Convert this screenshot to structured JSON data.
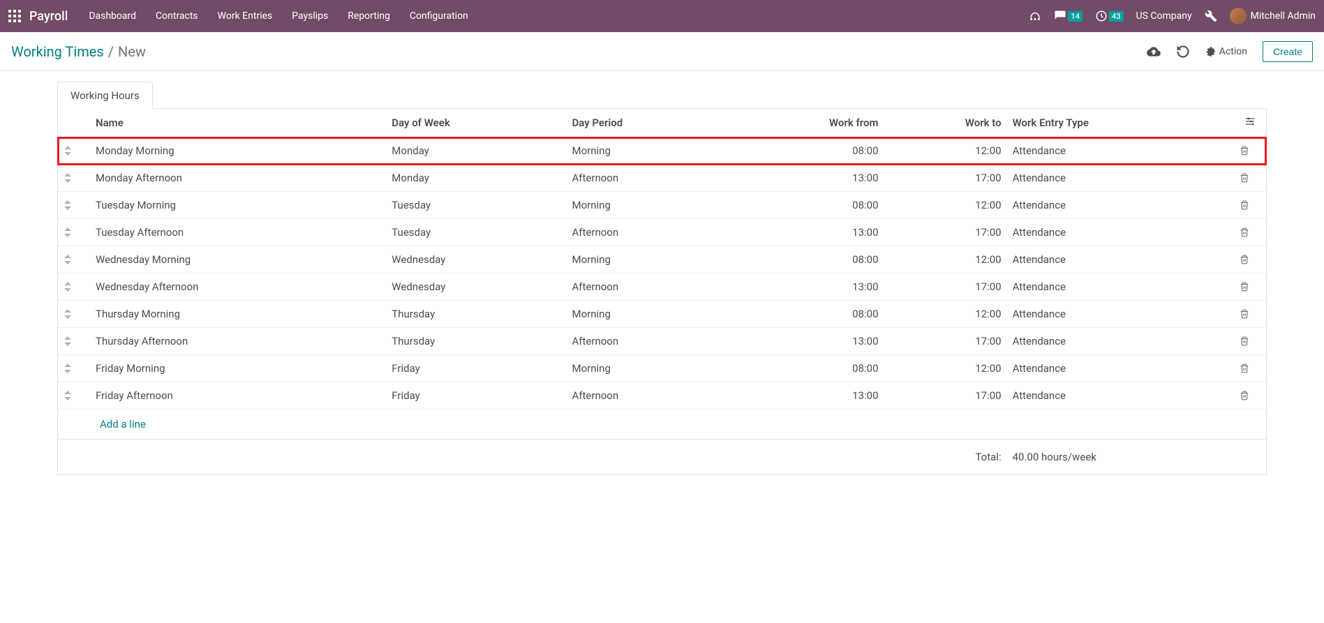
{
  "nav": {
    "app": "Payroll",
    "menu": [
      "Dashboard",
      "Contracts",
      "Work Entries",
      "Payslips",
      "Reporting",
      "Configuration"
    ],
    "chat_badge": "14",
    "clock_badge": "43",
    "company": "US Company",
    "user": "Mitchell Admin"
  },
  "breadcrumb": {
    "link": "Working Times",
    "current": "New"
  },
  "controls": {
    "action": "Action",
    "create": "Create"
  },
  "tab": "Working Hours",
  "columns": {
    "name": "Name",
    "day": "Day of Week",
    "period": "Day Period",
    "from": "Work from",
    "to": "Work to",
    "type": "Work Entry Type"
  },
  "rows": [
    {
      "name": "Monday Morning",
      "day": "Monday",
      "period": "Morning",
      "from": "08:00",
      "to": "12:00",
      "type": "Attendance",
      "hl": true
    },
    {
      "name": "Monday Afternoon",
      "day": "Monday",
      "period": "Afternoon",
      "from": "13:00",
      "to": "17:00",
      "type": "Attendance"
    },
    {
      "name": "Tuesday Morning",
      "day": "Tuesday",
      "period": "Morning",
      "from": "08:00",
      "to": "12:00",
      "type": "Attendance"
    },
    {
      "name": "Tuesday Afternoon",
      "day": "Tuesday",
      "period": "Afternoon",
      "from": "13:00",
      "to": "17:00",
      "type": "Attendance"
    },
    {
      "name": "Wednesday Morning",
      "day": "Wednesday",
      "period": "Morning",
      "from": "08:00",
      "to": "12:00",
      "type": "Attendance"
    },
    {
      "name": "Wednesday Afternoon",
      "day": "Wednesday",
      "period": "Afternoon",
      "from": "13:00",
      "to": "17:00",
      "type": "Attendance"
    },
    {
      "name": "Thursday Morning",
      "day": "Thursday",
      "period": "Morning",
      "from": "08:00",
      "to": "12:00",
      "type": "Attendance"
    },
    {
      "name": "Thursday Afternoon",
      "day": "Thursday",
      "period": "Afternoon",
      "from": "13:00",
      "to": "17:00",
      "type": "Attendance"
    },
    {
      "name": "Friday Morning",
      "day": "Friday",
      "period": "Morning",
      "from": "08:00",
      "to": "12:00",
      "type": "Attendance"
    },
    {
      "name": "Friday Afternoon",
      "day": "Friday",
      "period": "Afternoon",
      "from": "13:00",
      "to": "17:00",
      "type": "Attendance"
    }
  ],
  "add_line": "Add a line",
  "total": {
    "label": "Total:",
    "value": "40.00",
    "unit": "hours/week"
  }
}
